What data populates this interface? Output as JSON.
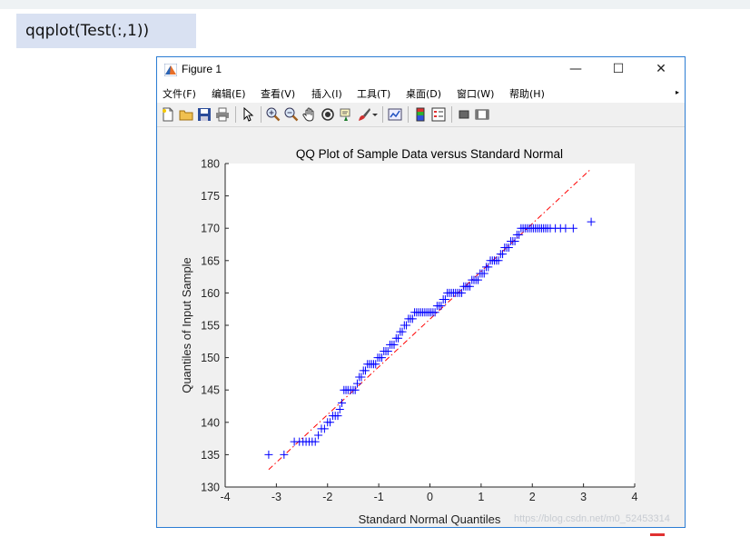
{
  "command": {
    "text": "qqplot(Test(:,1))"
  },
  "window": {
    "title": "Figure 1",
    "controls": {
      "minimize": "—",
      "maximize": "☐",
      "close": "✕"
    }
  },
  "menu": {
    "items": [
      "文件(F)",
      "编辑(E)",
      "查看(V)",
      "插入(I)",
      "工具(T)",
      "桌面(D)",
      "窗口(W)",
      "帮助(H)"
    ],
    "overflow": "▸"
  },
  "toolbar": {
    "icons": [
      "new-figure-icon",
      "open-file-icon",
      "save-icon",
      "print-icon",
      "pointer-icon",
      "zoom-in-icon",
      "zoom-out-icon",
      "pan-icon",
      "rotate-3d-icon",
      "data-cursor-icon",
      "brush-icon",
      "brush-dropdown-icon",
      "link-plot-icon",
      "colorbar-icon",
      "legend-icon",
      "hide-plot-tools-icon",
      "show-plot-tools-icon"
    ]
  },
  "chart_data": {
    "type": "scatter",
    "title": "QQ Plot of Sample Data versus Standard Normal",
    "xlabel": "Standard Normal Quantiles",
    "ylabel": "Quantiles of Input Sample",
    "xlim": [
      -4,
      4
    ],
    "ylim": [
      130,
      180
    ],
    "xticks": [
      "-4",
      "-3",
      "-2",
      "-1",
      "0",
      "1",
      "2",
      "3",
      "4"
    ],
    "yticks": [
      "130",
      "135",
      "140",
      "145",
      "150",
      "155",
      "160",
      "165",
      "170",
      "175",
      "180"
    ],
    "grid": false,
    "marker": "+",
    "marker_color": "#0000ff",
    "reference_line": {
      "style": "dash-dot",
      "color": "#ff0000",
      "x": [
        -3.15,
        3.15
      ],
      "y": [
        132.7,
        179.2
      ]
    },
    "series": [
      {
        "x": [
          -3.15,
          -2.85,
          -2.65,
          -2.55,
          -2.48,
          -2.42,
          -2.36,
          -2.3,
          -2.24,
          -2.18,
          -2.12,
          -2.06,
          -2.0,
          -1.95,
          -1.9,
          -1.85,
          -1.8,
          -1.76,
          -1.72,
          -1.68,
          -1.64,
          -1.6,
          -1.55,
          -1.5,
          -1.46,
          -1.42,
          -1.38,
          -1.34,
          -1.3,
          -1.26,
          -1.22,
          -1.18,
          -1.14,
          -1.1,
          -1.06,
          -1.02,
          -0.98,
          -0.94,
          -0.9,
          -0.86,
          -0.82,
          -0.78,
          -0.74,
          -0.7,
          -0.66,
          -0.62,
          -0.58,
          -0.54,
          -0.5,
          -0.46,
          -0.42,
          -0.38,
          -0.34,
          -0.3,
          -0.26,
          -0.22,
          -0.18,
          -0.14,
          -0.1,
          -0.06,
          -0.02,
          0.02,
          0.06,
          0.1,
          0.14,
          0.18,
          0.22,
          0.26,
          0.3,
          0.34,
          0.38,
          0.42,
          0.46,
          0.5,
          0.54,
          0.58,
          0.62,
          0.66,
          0.7,
          0.74,
          0.78,
          0.82,
          0.86,
          0.9,
          0.94,
          0.98,
          1.02,
          1.06,
          1.1,
          1.14,
          1.18,
          1.22,
          1.26,
          1.3,
          1.34,
          1.38,
          1.42,
          1.46,
          1.5,
          1.54,
          1.58,
          1.62,
          1.66,
          1.7,
          1.74,
          1.78,
          1.82,
          1.86,
          1.9,
          1.94,
          1.98,
          2.02,
          2.06,
          2.1,
          2.14,
          2.18,
          2.22,
          2.26,
          2.3,
          2.35,
          2.45,
          2.55,
          2.65,
          2.8,
          3.15
        ],
        "y": [
          135,
          135,
          137,
          137,
          137,
          137,
          137,
          137,
          137,
          138,
          139,
          139,
          140,
          140,
          141,
          141,
          141,
          142,
          143,
          145,
          145,
          145,
          145,
          145,
          145,
          146,
          147,
          147,
          148,
          148,
          149,
          149,
          149,
          149,
          149,
          150,
          150,
          150,
          151,
          151,
          151,
          152,
          152,
          152,
          153,
          153,
          154,
          154,
          155,
          155,
          156,
          156,
          156,
          157,
          157,
          157,
          157,
          157,
          157,
          157,
          157,
          157,
          157,
          157,
          158,
          158,
          158,
          159,
          159,
          160,
          160,
          160,
          160,
          160,
          160,
          160,
          160,
          161,
          161,
          161,
          161,
          162,
          162,
          162,
          162,
          163,
          163,
          163,
          164,
          164,
          165,
          165,
          165,
          165,
          165,
          166,
          166,
          167,
          167,
          167,
          168,
          168,
          168,
          169,
          169,
          170,
          170,
          170,
          170,
          170,
          170,
          170,
          170,
          170,
          170,
          170,
          170,
          170,
          170,
          170,
          170,
          170,
          170,
          170,
          171
        ]
      }
    ]
  },
  "watermark": {
    "text": "https://blog.csdn.net/m0_52453314"
  }
}
